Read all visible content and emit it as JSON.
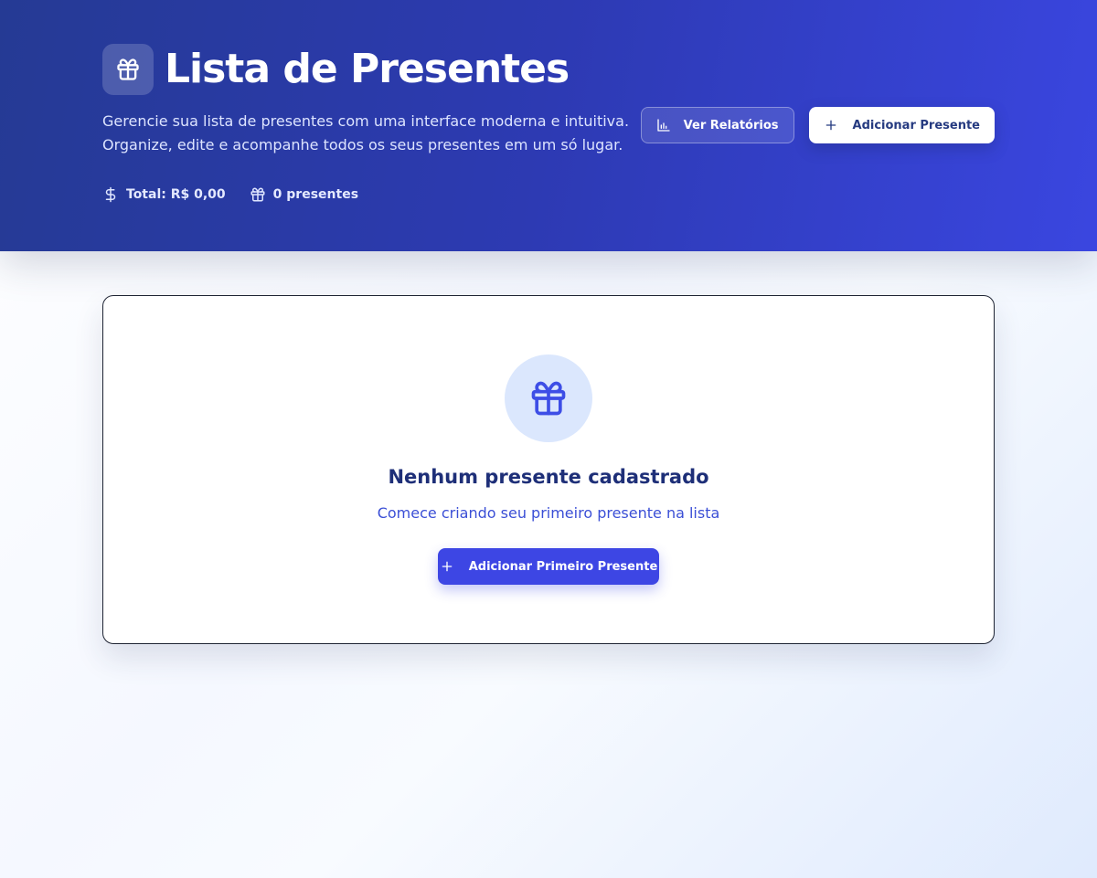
{
  "header": {
    "title": "Lista de Presentes",
    "subtitle_line1": "Gerencie sua lista de presentes com uma interface moderna e intuitiva.",
    "subtitle_line2": "Organize, edite e acompanhe todos os seus presentes em um só lugar.",
    "stats": {
      "total": "Total: R$ 0,00",
      "count": "0 presentes"
    },
    "actions": {
      "reports_label": "Ver Relatórios",
      "add_label": "Adicionar Presente"
    },
    "icons": {
      "logo": "gift-icon",
      "total": "dollar-icon",
      "count": "gift-icon",
      "reports": "bar-chart-icon",
      "add": "plus-icon"
    }
  },
  "empty_state": {
    "icon": "gift-icon",
    "title": "Nenhum presente cadastrado",
    "description": "Comece criando seu primeiro presente na lista",
    "button_label": "Adicionar Primeiro Presente"
  },
  "colors": {
    "hero_start": "#253a94",
    "hero_end": "#3a46e0",
    "primary": "#3d46e4",
    "heading": "#1e2f78",
    "accent_text": "#3b4fd6",
    "icon_circle": "#dbe7fd"
  }
}
